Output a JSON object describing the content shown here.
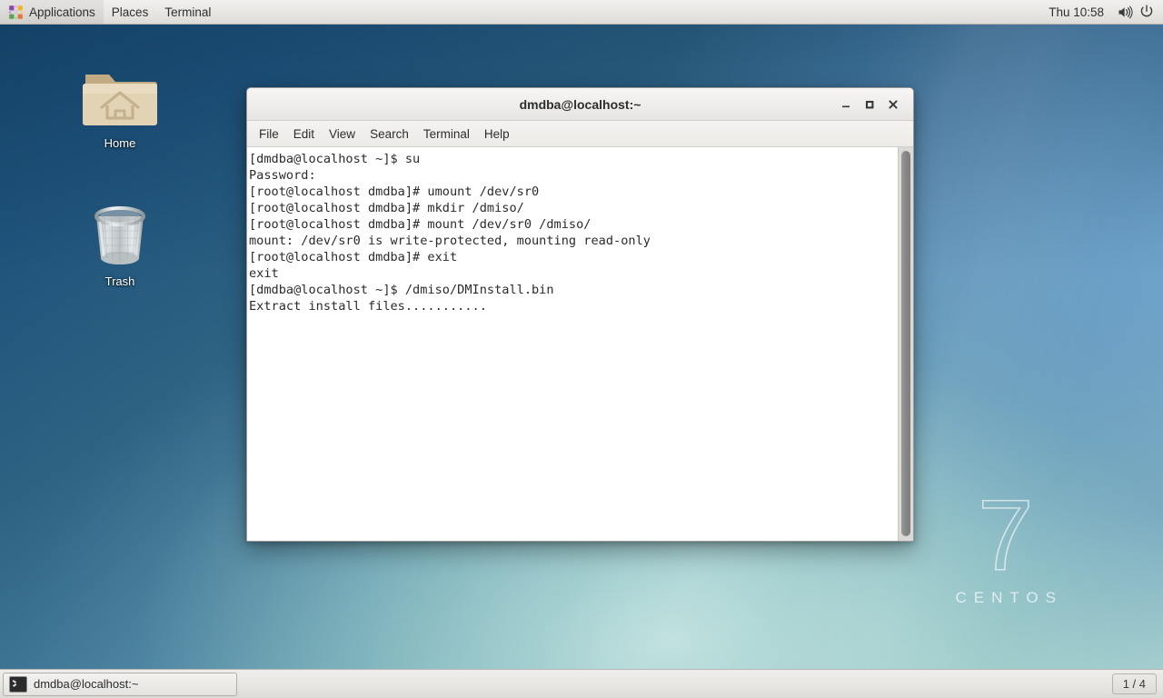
{
  "panel": {
    "apps_icon": "applications-pinwheel-icon",
    "applications_label": "Applications",
    "places_label": "Places",
    "terminal_label": "Terminal",
    "clock": "Thu 10:58",
    "volume_icon": "volume-icon",
    "power_icon": "power-icon"
  },
  "desktop": {
    "watermark_number": "7",
    "watermark_name": "CENTOS",
    "icons": [
      {
        "name": "home-folder-icon",
        "label": "Home"
      },
      {
        "name": "trash-icon",
        "label": "Trash"
      }
    ]
  },
  "window": {
    "title": "dmdba@localhost:~",
    "buttons": {
      "minimize": "–",
      "maximize": "□",
      "close": "✕"
    },
    "menu": [
      {
        "label": "File"
      },
      {
        "label": "Edit"
      },
      {
        "label": "View"
      },
      {
        "label": "Search"
      },
      {
        "label": "Terminal"
      },
      {
        "label": "Help"
      }
    ],
    "terminal_lines": [
      "[dmdba@localhost ~]$ su",
      "Password:",
      "[root@localhost dmdba]# umount /dev/sr0",
      "[root@localhost dmdba]# mkdir /dmiso/",
      "[root@localhost dmdba]# mount /dev/sr0 /dmiso/",
      "mount: /dev/sr0 is write-protected, mounting read-only",
      "[root@localhost dmdba]# exit",
      "exit",
      "[dmdba@localhost ~]$ /dmiso/DMInstall.bin",
      "Extract install files..........."
    ]
  },
  "taskbar": {
    "task_icon": "terminal-icon",
    "task_label": "dmdba@localhost:~",
    "workspace_indicator": "1 / 4"
  },
  "colors": {
    "panel_bg": "#e8e7e4",
    "window_bg": "#f6f5f4",
    "terminal_bg": "#ffffff",
    "terminal_fg": "#2b2b2b",
    "wallpaper_dark": "#17486e",
    "wallpaper_light": "#b6dad5",
    "wallpaper_blue": "#5183b8"
  }
}
